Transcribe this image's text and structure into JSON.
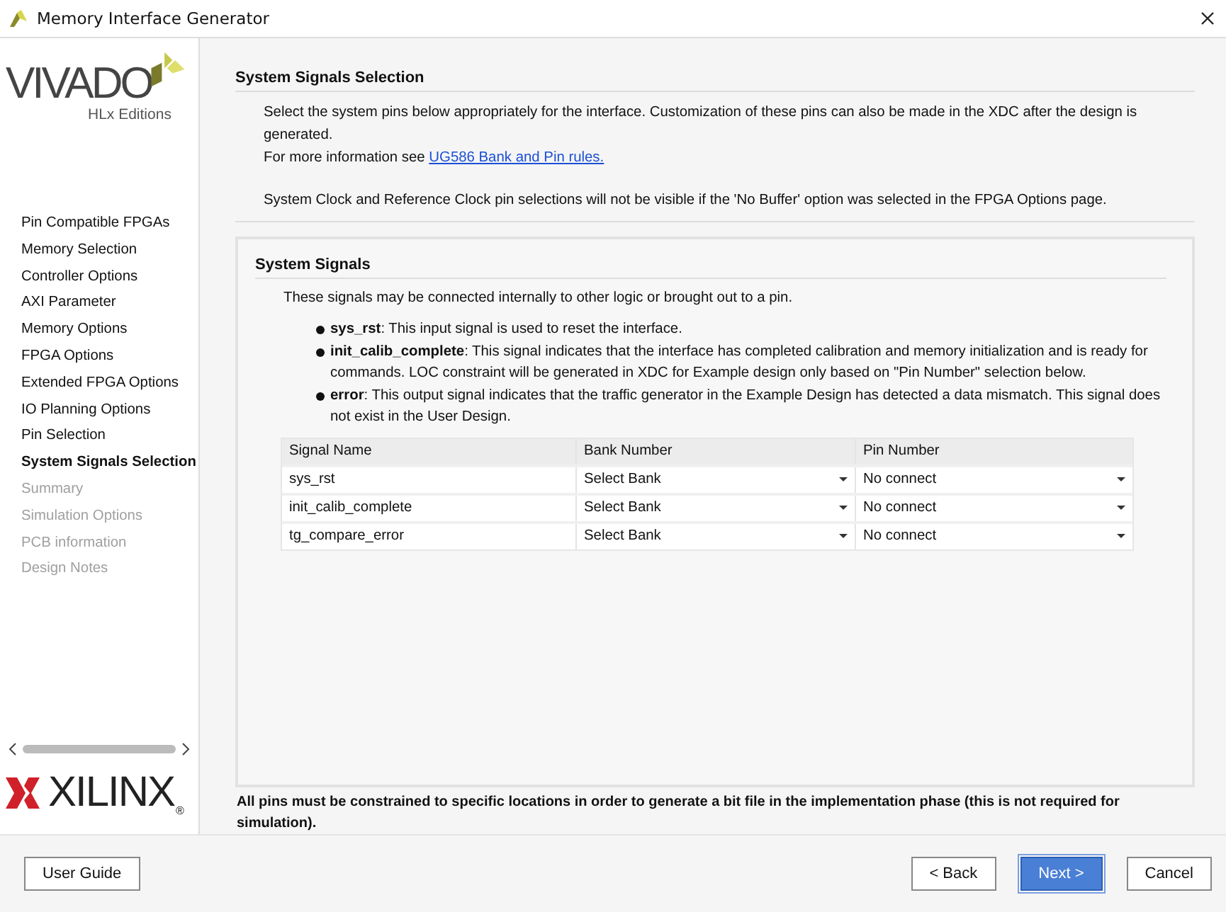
{
  "window": {
    "title": "Memory Interface Generator"
  },
  "logo": {
    "product": "VIVADO",
    "edition": "HLx Editions",
    "company": "XILINX",
    "registered": "®"
  },
  "sidebar": {
    "items": [
      {
        "label": "Pin Compatible FPGAs",
        "selected": false,
        "disabled": false
      },
      {
        "label": "Memory Selection",
        "selected": false,
        "disabled": false
      },
      {
        "label": "Controller Options",
        "selected": false,
        "disabled": false
      },
      {
        "label": "AXI Parameter",
        "selected": false,
        "disabled": false
      },
      {
        "label": "Memory Options",
        "selected": false,
        "disabled": false
      },
      {
        "label": "FPGA Options",
        "selected": false,
        "disabled": false
      },
      {
        "label": "Extended FPGA Options",
        "selected": false,
        "disabled": false
      },
      {
        "label": "IO Planning Options",
        "selected": false,
        "disabled": false
      },
      {
        "label": "Pin Selection",
        "selected": false,
        "disabled": false
      },
      {
        "label": "System Signals Selection",
        "selected": true,
        "disabled": false
      },
      {
        "label": "Summary",
        "selected": false,
        "disabled": true
      },
      {
        "label": "Simulation Options",
        "selected": false,
        "disabled": true
      },
      {
        "label": "PCB information",
        "selected": false,
        "disabled": true
      },
      {
        "label": "Design Notes",
        "selected": false,
        "disabled": true
      }
    ]
  },
  "page": {
    "heading": "System Signals Selection",
    "intro": "Select the system pins below appropriately for the interface. Customization of these pins can also be made in the XDC after the design is generated.",
    "more_info": "For more information see",
    "link": "UG586 Bank and Pin rules.",
    "clock_note": "System Clock and Reference Clock pin selections will not be visible if the 'No Buffer' option was selected in the FPGA Options page."
  },
  "panel": {
    "heading": "System Signals",
    "description": "These signals may be connected internally to other logic or brought out to a pin.",
    "bullets": [
      "**sys_rst**: This input signal is used to reset the interface.",
      "**init_calib_complete**: This signal indicates that the interface has completed calibration and memory initialization and is ready for commands. LOC constraint will be generated in XDC for Example design only based on \"Pin Number\" selection below.",
      "**error**: This output signal indicates that the traffic generator in the Example Design has detected a data mismatch. This signal does not exist in the User Design."
    ]
  },
  "table": {
    "columns": [
      "Signal Name",
      "Bank Number",
      "Pin Number"
    ],
    "rows": [
      {
        "signal": "sys_rst",
        "bank": "Select Bank",
        "pin": "No connect"
      },
      {
        "signal": "init_calib_complete",
        "bank": "Select Bank",
        "pin": "No connect"
      },
      {
        "signal": "tg_compare_error",
        "bank": "Select Bank",
        "pin": "No connect"
      }
    ]
  },
  "footnote": "All pins must be constrained to specific locations in order to generate a bit file in the implementation phase (this is not required for simulation).",
  "buttons": [
    {
      "label": "User Guide",
      "default": false
    },
    {
      "label": "< Back",
      "default": false
    },
    {
      "label": "Next >",
      "default": true
    },
    {
      "label": "Cancel",
      "default": false
    }
  ]
}
